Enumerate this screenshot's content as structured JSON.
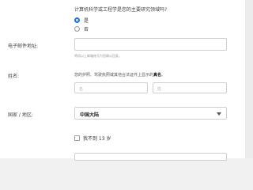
{
  "question": {
    "text": "计算机科学或工程学是您的主要研究领域吗?"
  },
  "radio": {
    "yes_label": "是",
    "no_label": "否",
    "selected": "yes"
  },
  "email": {
    "label": "电子邮件地址:",
    "hint": "将用以上邮箱账号为您确认回复。"
  },
  "name": {
    "label": "姓名:",
    "note_prefix": "您的护照、驾驶执照或其他合法证件上显示的",
    "note_bold": "真名",
    "note_suffix": "。",
    "first_placeholder": "名",
    "last_placeholder": "姓"
  },
  "region": {
    "label": "国家 / 地区:",
    "selected": "中国大陆"
  },
  "age_check": {
    "label": "我不到 13 岁"
  },
  "colors": {
    "accent": "#1a73e8",
    "border": "#cfcfcf"
  }
}
